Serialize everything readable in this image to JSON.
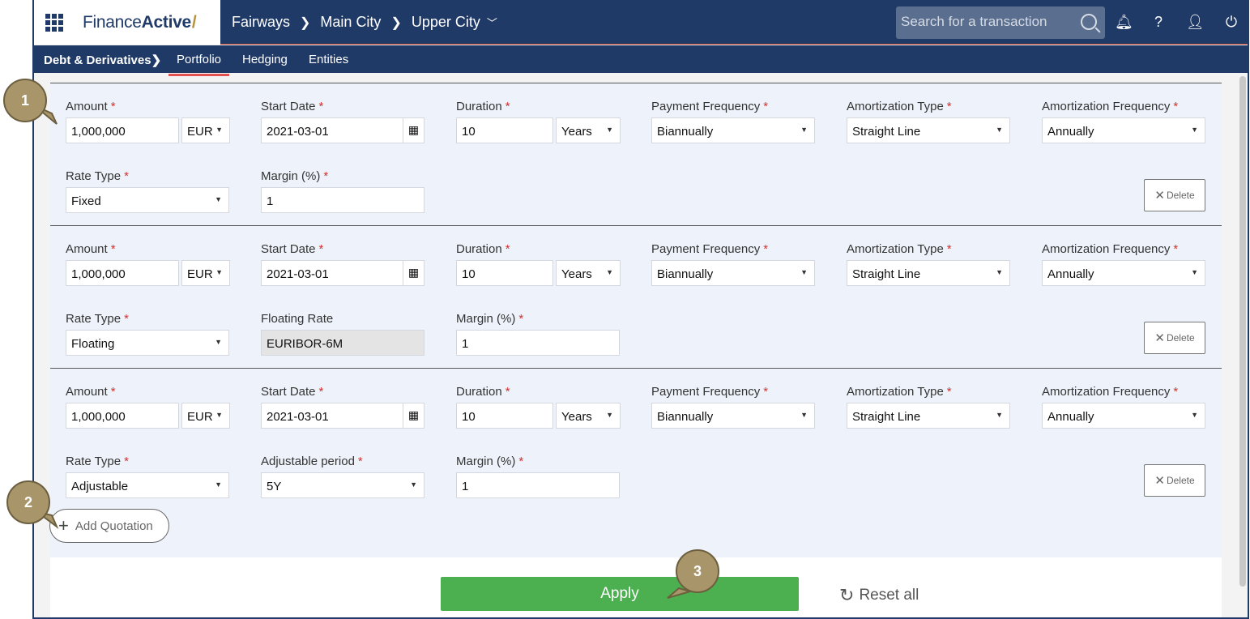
{
  "brand": {
    "name_light": "Finance",
    "name_bold": "Active",
    "slash": "/"
  },
  "breadcrumb": [
    "Fairways",
    "Main City",
    "Upper City"
  ],
  "search": {
    "placeholder": "Search for a transaction"
  },
  "top_icons": [
    "bell-icon",
    "help-icon",
    "user-icon",
    "power-icon"
  ],
  "subnav": {
    "section": "Debt & Derivatives",
    "tabs": [
      "Portfolio",
      "Hedging",
      "Entities"
    ],
    "active": "Portfolio"
  },
  "labels": {
    "amount": "Amount",
    "start_date": "Start Date",
    "duration": "Duration",
    "payment_frequency": "Payment Frequency",
    "amortization_type": "Amortization Type",
    "amortization_frequency": "Amortization Frequency",
    "rate_type": "Rate Type",
    "margin": "Margin (%)",
    "floating_rate": "Floating Rate",
    "adjustable_period": "Adjustable period"
  },
  "quotations": [
    {
      "amount": "1,000,000",
      "currency": "EUR",
      "start_date": "2021-03-01",
      "duration": "10",
      "duration_unit": "Years",
      "payment_frequency": "Biannually",
      "amortization_type": "Straight Line",
      "amortization_frequency": "Annually",
      "rate_type": "Fixed",
      "margin": "1"
    },
    {
      "amount": "1,000,000",
      "currency": "EUR",
      "start_date": "2021-03-01",
      "duration": "10",
      "duration_unit": "Years",
      "payment_frequency": "Biannually",
      "amortization_type": "Straight Line",
      "amortization_frequency": "Annually",
      "rate_type": "Floating",
      "floating_rate": "EURIBOR-6M",
      "margin": "1"
    },
    {
      "amount": "1,000,000",
      "currency": "EUR",
      "start_date": "2021-03-01",
      "duration": "10",
      "duration_unit": "Years",
      "payment_frequency": "Biannually",
      "amortization_type": "Straight Line",
      "amortization_frequency": "Annually",
      "rate_type": "Adjustable",
      "adjustable_period": "5Y",
      "margin": "1"
    }
  ],
  "buttons": {
    "delete": "Delete",
    "add_quotation": "Add Quotation",
    "apply": "Apply",
    "reset_all": "Reset all"
  },
  "callouts": [
    "1",
    "2",
    "3"
  ],
  "colors": {
    "navy": "#1f3a67",
    "apply_green": "#4caf50",
    "required_red": "#d0312d",
    "callout": "#a8966a"
  }
}
